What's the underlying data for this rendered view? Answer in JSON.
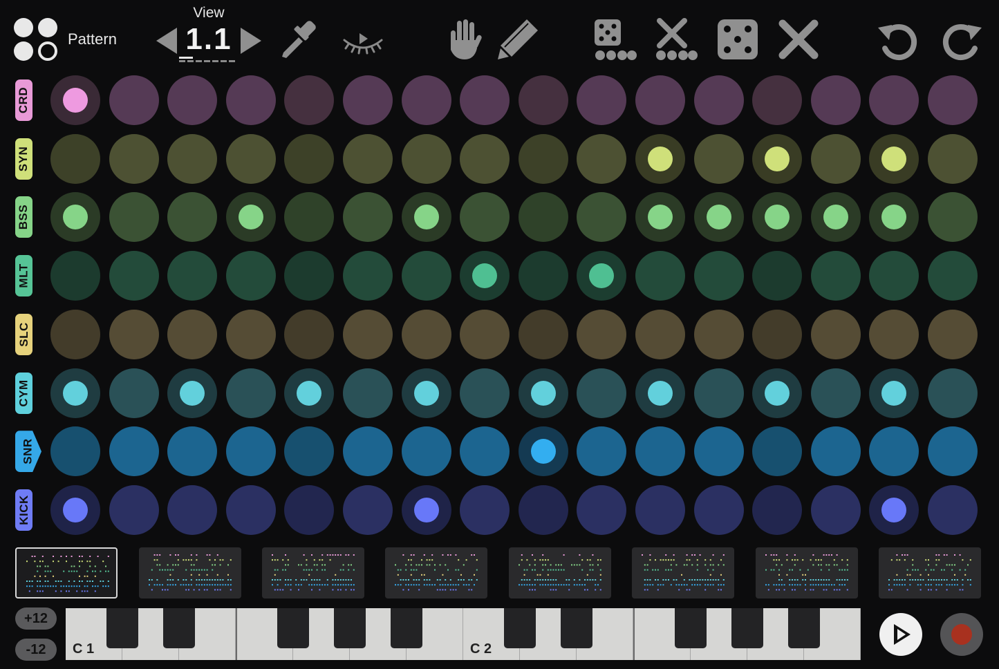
{
  "header": {
    "pattern_label": "Pattern",
    "view_label": "View",
    "view_value": "1.1"
  },
  "icons": {
    "logo": "four-dots-logo-icon",
    "view_prev": "triangle-left-icon",
    "view_next": "triangle-right-icon",
    "tools": [
      "eyedropper-icon",
      "eye-closed-icon",
      "hand-icon",
      "pencil-icon",
      "dice-row-icon",
      "clear-row-icon",
      "dice-icon",
      "clear-icon",
      "undo-icon",
      "redo-icon"
    ]
  },
  "tracks": [
    {
      "name": "CRD",
      "label_color": "#e89ad7",
      "pad_color": "#553a55",
      "pad_dim": "#45303f",
      "halo": "#3a2a36",
      "active_color": "#ee9ae0",
      "selected": false,
      "steps": [
        1,
        0,
        0,
        0,
        0,
        0,
        0,
        0,
        0,
        0,
        0,
        0,
        0,
        0,
        0,
        0
      ]
    },
    {
      "name": "SYN",
      "label_color": "#cfe07a",
      "pad_color": "#4d5133",
      "pad_dim": "#3d4128",
      "halo": "#393c24",
      "active_color": "#cfe07a",
      "selected": false,
      "steps": [
        0,
        0,
        0,
        0,
        0,
        0,
        0,
        0,
        0,
        0,
        1,
        0,
        1,
        0,
        1,
        0
      ]
    },
    {
      "name": "BSS",
      "label_color": "#86d488",
      "pad_color": "#3b5234",
      "pad_dim": "#2f4229",
      "halo": "#2b3b26",
      "active_color": "#86d488",
      "selected": false,
      "steps": [
        1,
        0,
        0,
        1,
        0,
        0,
        1,
        0,
        0,
        0,
        1,
        1,
        1,
        1,
        1,
        0
      ]
    },
    {
      "name": "MLT",
      "label_color": "#56c496",
      "pad_color": "#234b3a",
      "pad_dim": "#1c3b2e",
      "halo": "#1c3d30",
      "active_color": "#4fbf92",
      "selected": false,
      "steps": [
        0,
        0,
        0,
        0,
        0,
        0,
        0,
        1,
        0,
        1,
        0,
        0,
        0,
        0,
        0,
        0
      ]
    },
    {
      "name": "SLC",
      "label_color": "#e6d27c",
      "pad_color": "#554c35",
      "pad_dim": "#433c2a",
      "halo": "#3c3625",
      "active_color": "#e6d27c",
      "selected": false,
      "steps": [
        0,
        0,
        0,
        0,
        0,
        0,
        0,
        0,
        0,
        0,
        0,
        0,
        0,
        0,
        0,
        0
      ]
    },
    {
      "name": "CYM",
      "label_color": "#5fd0dc",
      "pad_color": "#2a5157",
      "pad_dim": "#214046",
      "halo": "#1f3c41",
      "active_color": "#62d0dc",
      "selected": false,
      "steps": [
        1,
        0,
        1,
        0,
        1,
        0,
        1,
        0,
        1,
        0,
        1,
        0,
        1,
        0,
        1,
        0
      ]
    },
    {
      "name": "SNR",
      "label_color": "#35a8e8",
      "pad_color": "#1c6590",
      "pad_dim": "#17506f",
      "halo": "#143a52",
      "active_color": "#33aef0",
      "selected": true,
      "steps": [
        0,
        0,
        0,
        0,
        0,
        0,
        0,
        0,
        1,
        0,
        0,
        0,
        0,
        0,
        0,
        0
      ]
    },
    {
      "name": "KICK",
      "label_color": "#6f7cf5",
      "pad_color": "#2b3062",
      "pad_dim": "#22264f",
      "halo": "#1f2348",
      "active_color": "#6878f8",
      "selected": false,
      "steps": [
        1,
        0,
        0,
        0,
        0,
        0,
        1,
        0,
        0,
        0,
        0,
        0,
        0,
        0,
        1,
        0
      ]
    }
  ],
  "patterns": {
    "count": 8,
    "selected": 0
  },
  "keyboard": {
    "octave_up": "+12",
    "octave_down": "-12",
    "c1_label": "C 1",
    "c2_label": "C 2"
  },
  "transport": {
    "play_icon": "play-icon",
    "record_icon": "record-icon"
  },
  "colors": {
    "background": "#0c0c0d",
    "toolbar_icon": "#8e8e8e",
    "keyboard_white": "#d6d6d4",
    "keyboard_black": "#232325",
    "record": "#a8311f"
  }
}
